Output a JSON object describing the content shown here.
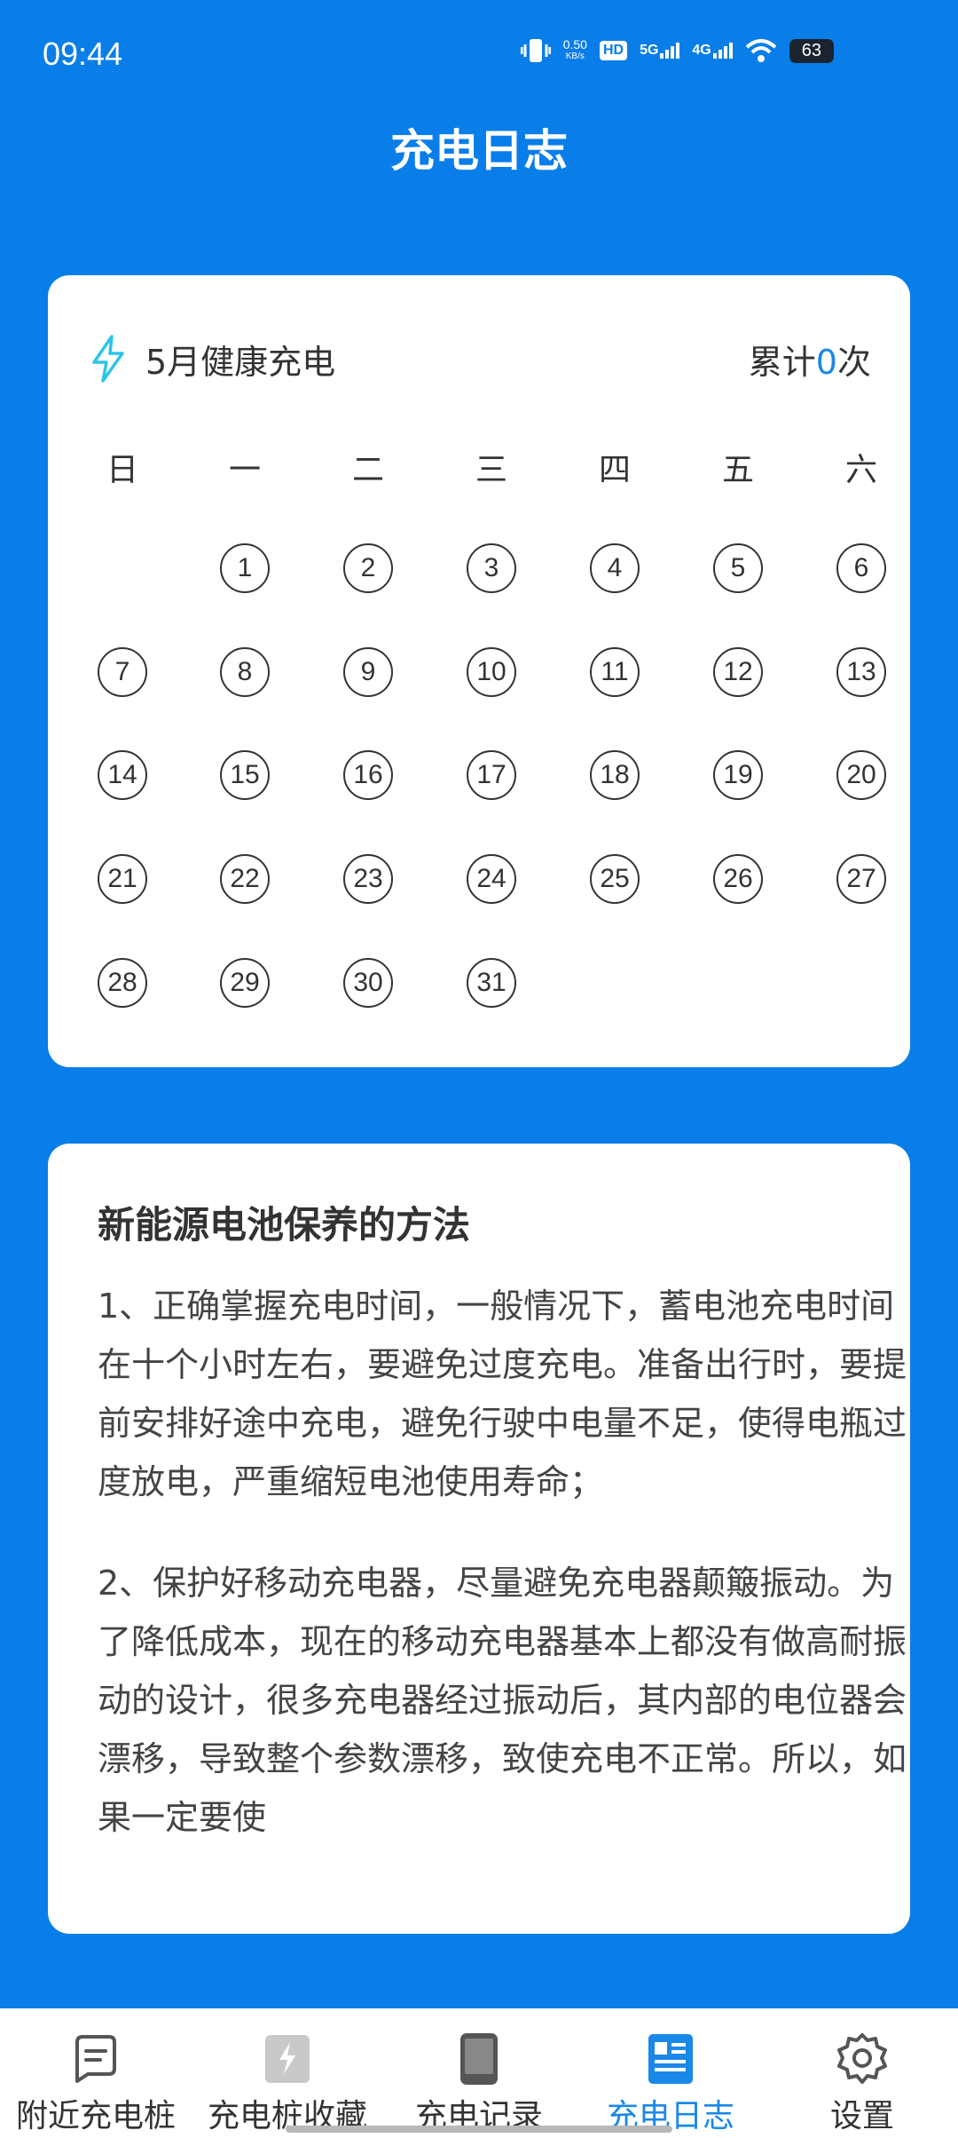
{
  "status_bar": {
    "time": "09:44",
    "speed_value": "0.50",
    "speed_unit": "KB/s",
    "hd": "HD",
    "net1": "5G",
    "net2": "4G",
    "battery": "63"
  },
  "header": {
    "title": "充电日志"
  },
  "calendar": {
    "month_label": "5月健康充电",
    "count_prefix": "累计",
    "count_value": "0",
    "count_suffix": "次",
    "weekdays": [
      "日",
      "一",
      "二",
      "三",
      "四",
      "五",
      "六"
    ],
    "days": [
      "1",
      "2",
      "3",
      "4",
      "5",
      "6",
      "7",
      "8",
      "9",
      "10",
      "11",
      "12",
      "13",
      "14",
      "15",
      "16",
      "17",
      "18",
      "19",
      "20",
      "21",
      "22",
      "23",
      "24",
      "25",
      "26",
      "27",
      "28",
      "29",
      "30",
      "31"
    ],
    "first_weekday_index": 1
  },
  "tips": {
    "title": "新能源电池保养的方法",
    "paragraphs": [
      "1、正确掌握充电时间，一般情况下，蓄电池充电时间在十个小时左右，要避免过度充电。准备出行时，要提前安排好途中充电，避免行驶中电量不足，使得电瓶过度放电，严重缩短电池使用寿命；",
      "2、保护好移动充电器，尽量避免充电器颠簸振动。为了降低成本，现在的移动充电器基本上都没有做高耐振动的设计，很多充电器经过振动后，其内部的电位器会漂移，导致整个参数漂移，致使充电不正常。所以，如果一定要使"
    ]
  },
  "tabbar": {
    "active_color": "#1a88e8",
    "items": [
      {
        "label": "附近充电桩",
        "icon": "message-list-icon"
      },
      {
        "label": "充电桩收藏",
        "icon": "charging-pile-icon"
      },
      {
        "label": "充电记录",
        "icon": "tablet-icon"
      },
      {
        "label": "充电日志",
        "icon": "log-document-icon"
      },
      {
        "label": "设置",
        "icon": "gear-icon"
      }
    ]
  }
}
